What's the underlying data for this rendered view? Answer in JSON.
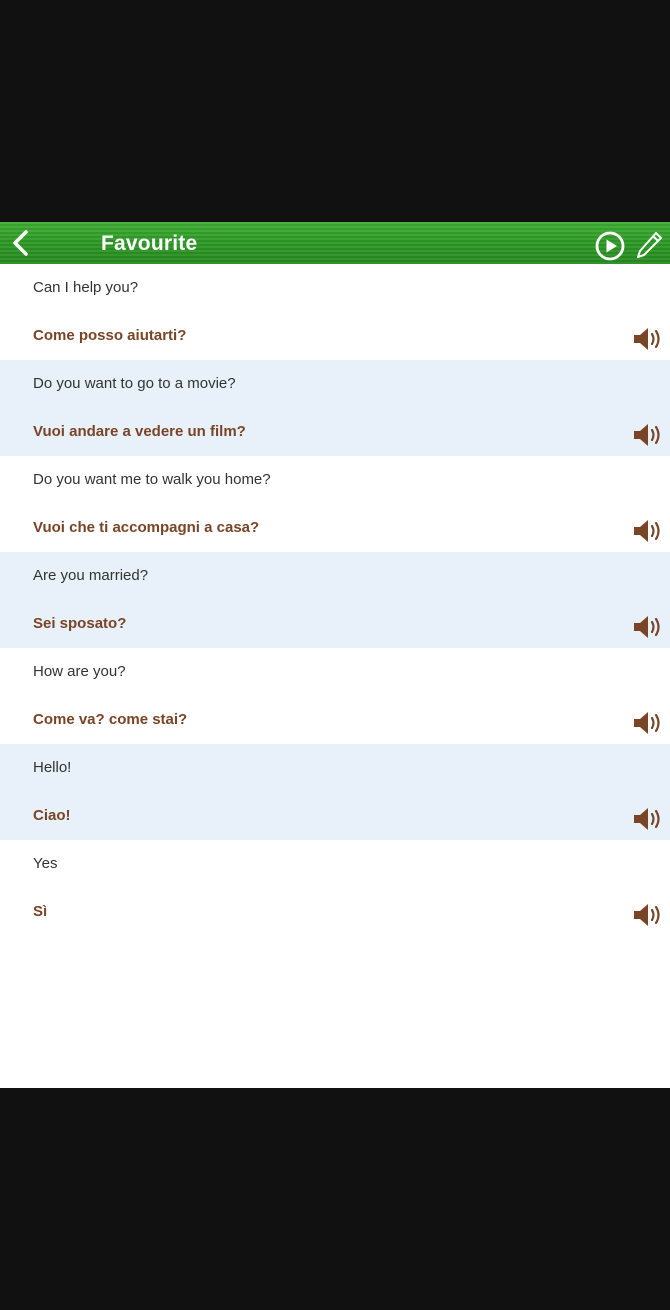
{
  "header": {
    "title": "Favourite",
    "back_icon": "chevron-left-icon",
    "play_icon": "play-circle-icon",
    "edit_icon": "pencil-icon"
  },
  "colors": {
    "header_green": "#2e9a26",
    "translation_brown": "#7a4427",
    "alt_row": "#e8f1fa",
    "speaker_brown": "#7a4427"
  },
  "phrases": [
    {
      "en": "Can I help you?",
      "it": "Come posso aiutarti?"
    },
    {
      "en": "Do you want to go to a movie?",
      "it": "Vuoi andare a vedere un film?"
    },
    {
      "en": "Do you want me to walk you home?",
      "it": "Vuoi che ti accompagni a casa?"
    },
    {
      "en": "Are you married?",
      "it": "Sei sposato?"
    },
    {
      "en": "How are you?",
      "it": "Come va? come stai?"
    },
    {
      "en": "Hello!",
      "it": "Ciao!"
    },
    {
      "en": "Yes",
      "it": "Sì"
    }
  ]
}
